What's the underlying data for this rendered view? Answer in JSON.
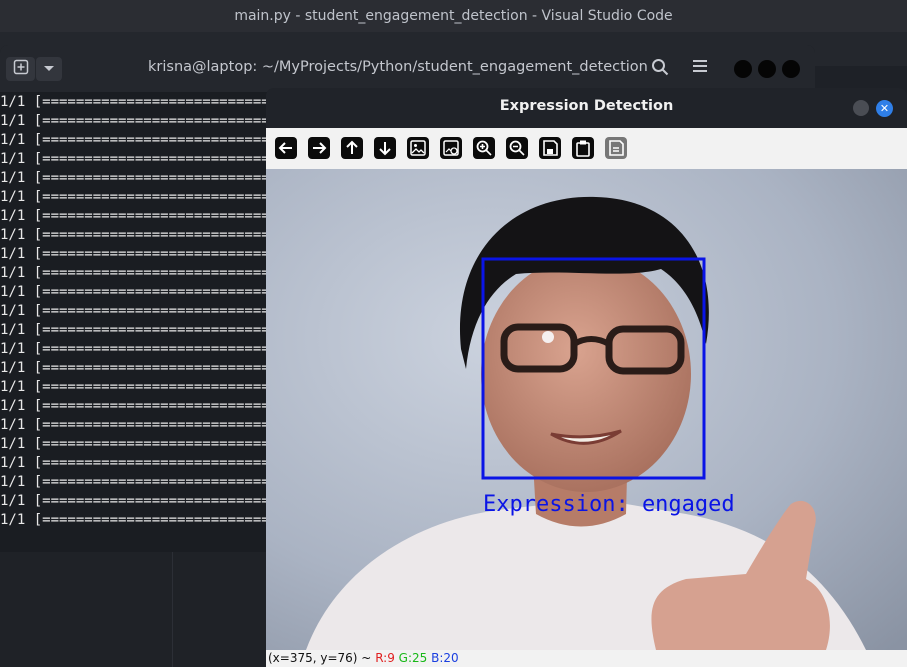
{
  "vscode": {
    "title": "main.py - student_engagement_detection - Visual Studio Code"
  },
  "terminal": {
    "title": "krisna@laptop: ~/MyProjects/Python/student_engagement_detection",
    "lines": [
      "1/1 [==============================",
      "1/1 [==============================",
      "1/1 [==============================",
      "1/1 [==============================",
      "1/1 [==============================",
      "1/1 [==============================",
      "1/1 [==============================",
      "1/1 [==============================",
      "1/1 [==============================",
      "1/1 [==============================",
      "1/1 [==============================",
      "1/1 [==============================",
      "1/1 [==============================",
      "1/1 [==============================",
      "1/1 [==============================",
      "1/1 [==============================",
      "1/1 [==============================",
      "1/1 [==============================",
      "1/1 [==============================",
      "1/1 [==============================",
      "1/1 [==============================",
      "1/1 [==============================",
      "1/1 [=============================="
    ],
    "icons": [
      "new-tab-icon",
      "dropdown-icon",
      "search-icon",
      "menu-icon"
    ]
  },
  "cv_window": {
    "title": "Expression Detection",
    "toolbar": [
      "arrow-left",
      "arrow-right",
      "arrow-up",
      "arrow-down",
      "image",
      "image-settings",
      "zoom-in",
      "zoom-out",
      "save",
      "copy-clipboard",
      "properties"
    ],
    "detection_label": "Expression: engaged",
    "status": {
      "coords": "(x=375, y=76) ~",
      "r": "R:9",
      "g": "G:25",
      "b": "B:20"
    },
    "box_color": "#0a14e6"
  }
}
